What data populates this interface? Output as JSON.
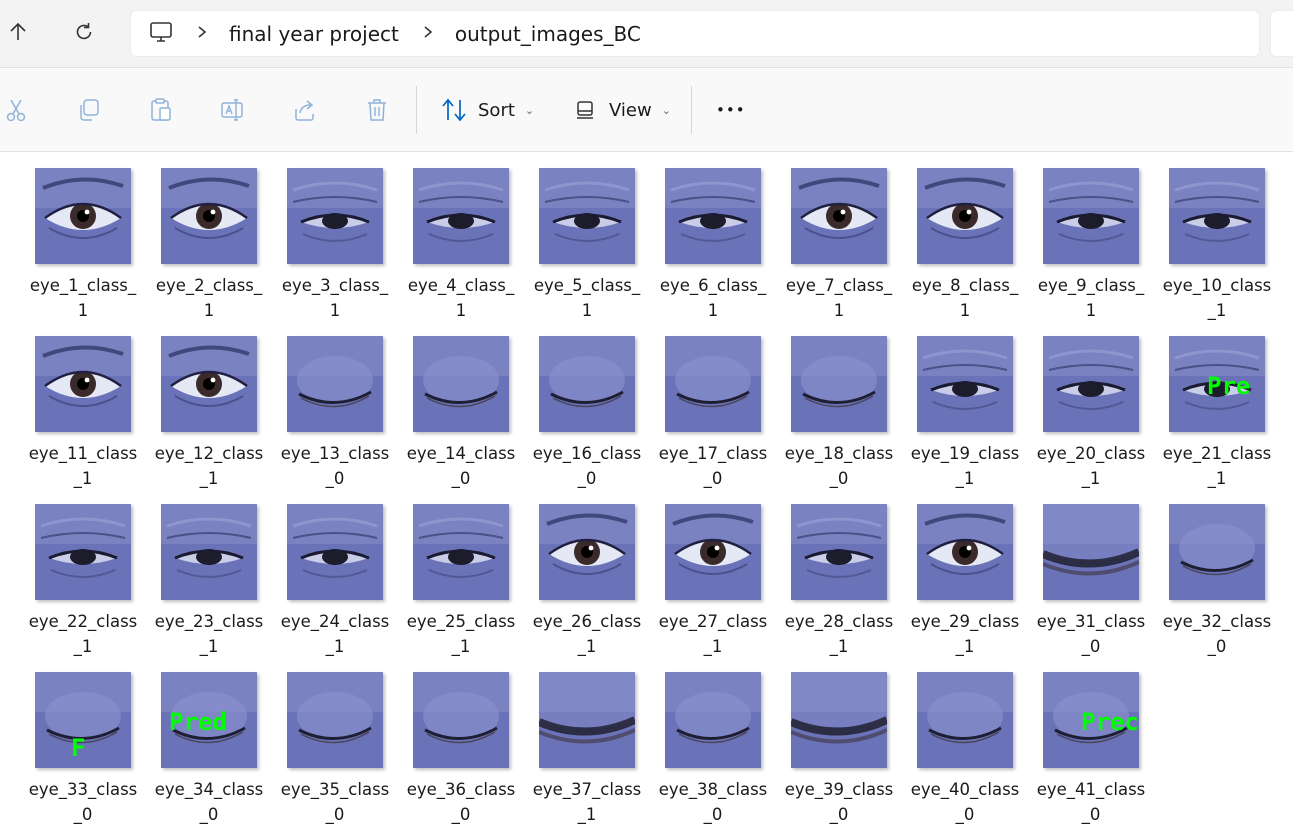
{
  "nav": {
    "up_icon": "arrow-up-icon",
    "refresh_icon": "refresh-icon"
  },
  "address": {
    "root_icon": "computer-icon",
    "segments": [
      "final year project",
      "output_images_BC"
    ]
  },
  "toolbar": {
    "sort_label": "Sort",
    "view_label": "View",
    "more_label": "•••"
  },
  "colors": {
    "accent": "#0067c0",
    "disabled_icon": "#8fb3d9",
    "label_overlay": "#00ff00"
  },
  "files": [
    {
      "name": "eye_1_class_1",
      "line1": "eye_1_class_",
      "line2": "1",
      "state": "open"
    },
    {
      "name": "eye_2_class_1",
      "line1": "eye_2_class_",
      "line2": "1",
      "state": "open"
    },
    {
      "name": "eye_3_class_1",
      "line1": "eye_3_class_",
      "line2": "1",
      "state": "half"
    },
    {
      "name": "eye_4_class_1",
      "line1": "eye_4_class_",
      "line2": "1",
      "state": "half"
    },
    {
      "name": "eye_5_class_1",
      "line1": "eye_5_class_",
      "line2": "1",
      "state": "half"
    },
    {
      "name": "eye_6_class_1",
      "line1": "eye_6_class_",
      "line2": "1",
      "state": "half"
    },
    {
      "name": "eye_7_class_1",
      "line1": "eye_7_class_",
      "line2": "1",
      "state": "open"
    },
    {
      "name": "eye_8_class_1",
      "line1": "eye_8_class_",
      "line2": "1",
      "state": "open"
    },
    {
      "name": "eye_9_class_1",
      "line1": "eye_9_class_",
      "line2": "1",
      "state": "half"
    },
    {
      "name": "eye_10_class_1",
      "line1": "eye_10_class",
      "line2": "_1",
      "state": "half"
    },
    {
      "name": "eye_11_class_1",
      "line1": "eye_11_class",
      "line2": "_1",
      "state": "open"
    },
    {
      "name": "eye_12_class_1",
      "line1": "eye_12_class",
      "line2": "_1",
      "state": "open"
    },
    {
      "name": "eye_13_class_0",
      "line1": "eye_13_class",
      "line2": "_0",
      "state": "closed"
    },
    {
      "name": "eye_14_class_0",
      "line1": "eye_14_class",
      "line2": "_0",
      "state": "closed"
    },
    {
      "name": "eye_16_class_0",
      "line1": "eye_16_class",
      "line2": "_0",
      "state": "closed"
    },
    {
      "name": "eye_17_class_0",
      "line1": "eye_17_class",
      "line2": "_0",
      "state": "closed"
    },
    {
      "name": "eye_18_class_0",
      "line1": "eye_18_class",
      "line2": "_0",
      "state": "closed"
    },
    {
      "name": "eye_19_class_1",
      "line1": "eye_19_class",
      "line2": "_1",
      "state": "half"
    },
    {
      "name": "eye_20_class_1",
      "line1": "eye_20_class",
      "line2": "_1",
      "state": "half"
    },
    {
      "name": "eye_21_class_1",
      "line1": "eye_21_class",
      "line2": "_1",
      "state": "half",
      "overlay": "Pre"
    },
    {
      "name": "eye_22_class_1",
      "line1": "eye_22_class",
      "line2": "_1",
      "state": "half"
    },
    {
      "name": "eye_23_class_1",
      "line1": "eye_23_class",
      "line2": "_1",
      "state": "half"
    },
    {
      "name": "eye_24_class_1",
      "line1": "eye_24_class",
      "line2": "_1",
      "state": "half"
    },
    {
      "name": "eye_25_class_1",
      "line1": "eye_25_class",
      "line2": "_1",
      "state": "half"
    },
    {
      "name": "eye_26_class_1",
      "line1": "eye_26_class",
      "line2": "_1",
      "state": "open"
    },
    {
      "name": "eye_27_class_1",
      "line1": "eye_27_class",
      "line2": "_1",
      "state": "open"
    },
    {
      "name": "eye_28_class_1",
      "line1": "eye_28_class",
      "line2": "_1",
      "state": "half"
    },
    {
      "name": "eye_29_class_1",
      "line1": "eye_29_class",
      "line2": "_1",
      "state": "open"
    },
    {
      "name": "eye_31_class_0",
      "line1": "eye_31_class",
      "line2": "_0",
      "state": "lashes"
    },
    {
      "name": "eye_32_class_0",
      "line1": "eye_32_class",
      "line2": "_0",
      "state": "closed"
    },
    {
      "name": "eye_33_class_0",
      "line1": "eye_33_class",
      "line2": "_0",
      "state": "closed",
      "overlay": "F"
    },
    {
      "name": "eye_34_class_0",
      "line1": "eye_34_class",
      "line2": "_0",
      "state": "closed",
      "overlay": "Pred"
    },
    {
      "name": "eye_35_class_0",
      "line1": "eye_35_class",
      "line2": "_0",
      "state": "closed"
    },
    {
      "name": "eye_36_class_0",
      "line1": "eye_36_class",
      "line2": "_0",
      "state": "closed"
    },
    {
      "name": "eye_37_class_1",
      "line1": "eye_37_class",
      "line2": "_1",
      "state": "lashes"
    },
    {
      "name": "eye_38_class_0",
      "line1": "eye_38_class",
      "line2": "_0",
      "state": "closed"
    },
    {
      "name": "eye_39_class_0",
      "line1": "eye_39_class",
      "line2": "_0",
      "state": "lashes"
    },
    {
      "name": "eye_40_class_0",
      "line1": "eye_40_class",
      "line2": "_0",
      "state": "closed"
    },
    {
      "name": "eye_41_class_0",
      "line1": "eye_41_class",
      "line2": "_0",
      "state": "closed",
      "overlay": "Prec"
    }
  ]
}
